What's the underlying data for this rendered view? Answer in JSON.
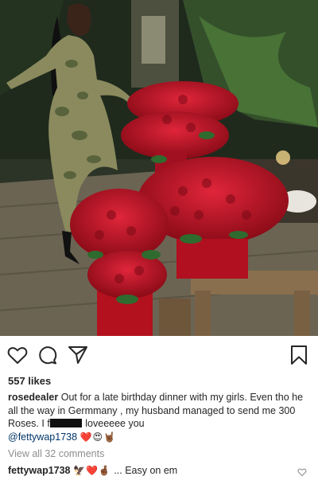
{
  "post": {
    "photo_alt": "",
    "likes": "557 likes",
    "caption": {
      "username": "rosedealer",
      "text_part1": "Out for a late birthday dinner with my girls. Even tho he all the way in Germmany , my husband managed to send me 300 Roses. I f",
      "text_part2": " loveeeee you",
      "mention": "@fettywap1738",
      "emojis": "❤️😍🤘🏾"
    },
    "view_comments": "View all 32 comments",
    "comment": {
      "username": "fettywap1738",
      "emojis": "🦅❤️🤞🏾",
      "text": "... Easy on em"
    }
  },
  "colors": {
    "text": "#262626",
    "muted": "#8e8e8e",
    "mention": "#003569",
    "rose": "#c8102e"
  },
  "icons": [
    "heart-icon",
    "comment-icon",
    "share-icon",
    "bookmark-icon",
    "small-heart-icon"
  ]
}
